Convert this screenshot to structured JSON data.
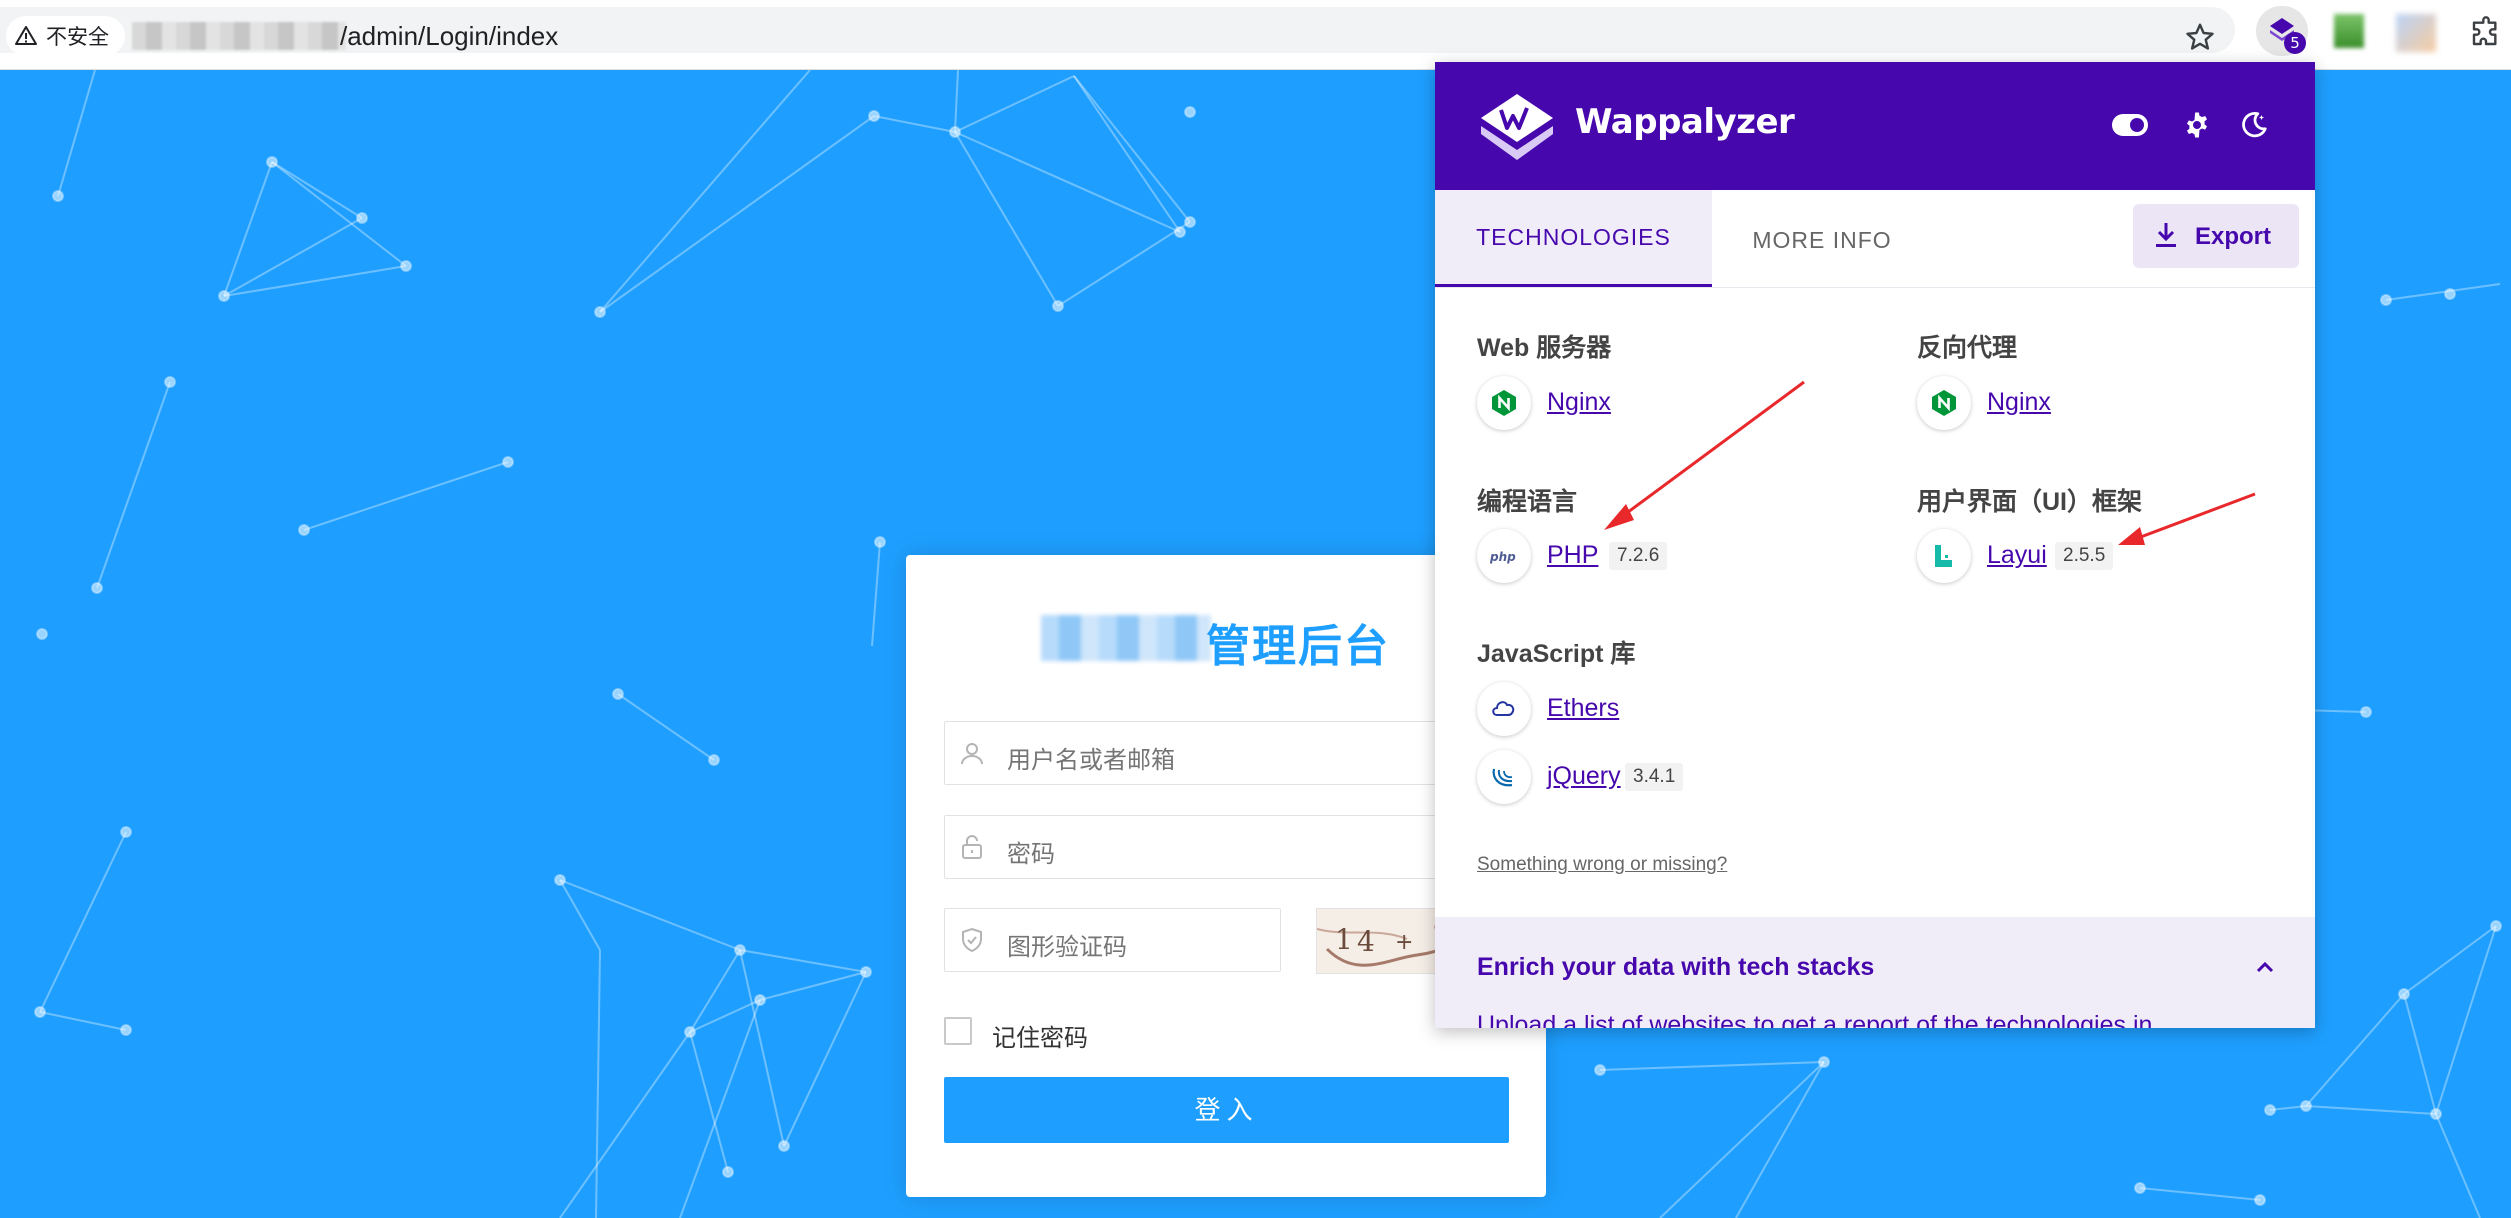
{
  "browser": {
    "security_label": "不安全",
    "url_visible": "/admin/Login/index",
    "extension_badge_count": "5"
  },
  "login": {
    "title_visible": "管理后台",
    "username_placeholder": "用户名或者邮箱",
    "password_placeholder": "密码",
    "captcha_placeholder": "图形验证码",
    "remember_label": "记住密码",
    "submit_label": "登入"
  },
  "wappalyzer": {
    "brand": "Wappalyzer",
    "tabs": [
      {
        "label": "TECHNOLOGIES",
        "active": true
      },
      {
        "label": "MORE INFO",
        "active": false
      }
    ],
    "export_label": "Export",
    "categories": [
      {
        "name": "Web 服务器",
        "technologies": [
          {
            "name": "Nginx",
            "version": "",
            "icon": "nginx-icon"
          }
        ]
      },
      {
        "name": "反向代理",
        "technologies": [
          {
            "name": "Nginx",
            "version": "",
            "icon": "nginx-icon"
          }
        ]
      },
      {
        "name": "编程语言",
        "technologies": [
          {
            "name": "PHP",
            "version": "7.2.6",
            "icon": "php-icon"
          }
        ]
      },
      {
        "name": "用户界面（UI）框架",
        "technologies": [
          {
            "name": "Layui",
            "version": "2.5.5",
            "icon": "layui-icon"
          }
        ]
      },
      {
        "name": "JavaScript 库",
        "technologies": [
          {
            "name": "Ethers",
            "version": "",
            "icon": "ethers-icon"
          },
          {
            "name": "jQuery",
            "version": "3.4.1",
            "icon": "jquery-icon"
          }
        ]
      }
    ],
    "wrong_link": "Something wrong or missing?",
    "enrich_title": "Enrich your data with tech stacks",
    "enrich_subtitle": "Upload a list of websites to get a report of the technologies in"
  },
  "colors": {
    "background": "#1E9FFF",
    "wappalyzer_purple": "#4608ad",
    "annotation_arrow": "#e8282b"
  }
}
